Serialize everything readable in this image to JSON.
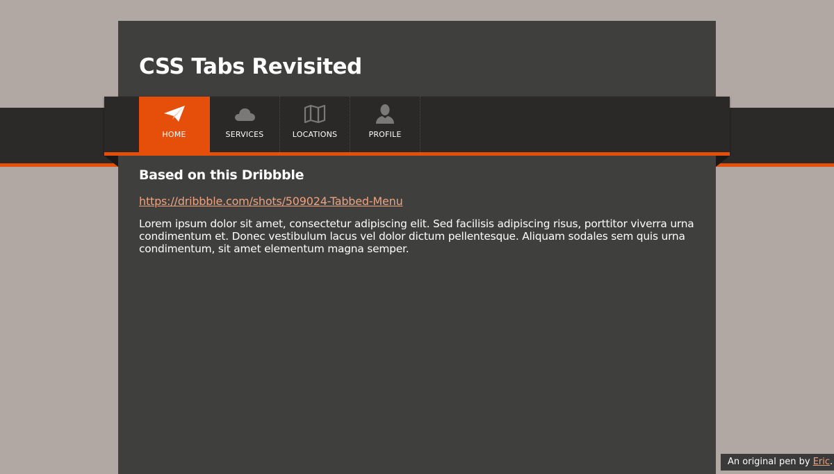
{
  "page": {
    "title": "CSS Tabs Revisited"
  },
  "tabs": [
    {
      "label": "HOME",
      "icon": "paper-plane-icon",
      "active": true
    },
    {
      "label": "SERVICES",
      "icon": "cloud-icon",
      "active": false
    },
    {
      "label": "LOCATIONS",
      "icon": "map-icon",
      "active": false
    },
    {
      "label": "PROFILE",
      "icon": "user-icon",
      "active": false
    }
  ],
  "content": {
    "heading": "Based on this Dribbble",
    "link": "https://dribbble.com/shots/509024-Tabbed-Menu",
    "body": "Lorem ipsum dolor sit amet, consectetur adipiscing elit. Sed facilisis adipiscing risus, porttitor viverra urna condimentum et. Donec vestibulum lacus vel dolor dictum pellentesque. Aliquam sodales sem quis urna condimentum, sit amet elementum magna semper."
  },
  "credit": {
    "prefix": "An original pen by ",
    "author": "Eric",
    "suffix": "."
  },
  "colors": {
    "accent": "#e64f0a",
    "background": "#b1a8a3",
    "card": "#3f3f3d",
    "tabbar": "#2a2927",
    "link": "#f0a27f"
  }
}
